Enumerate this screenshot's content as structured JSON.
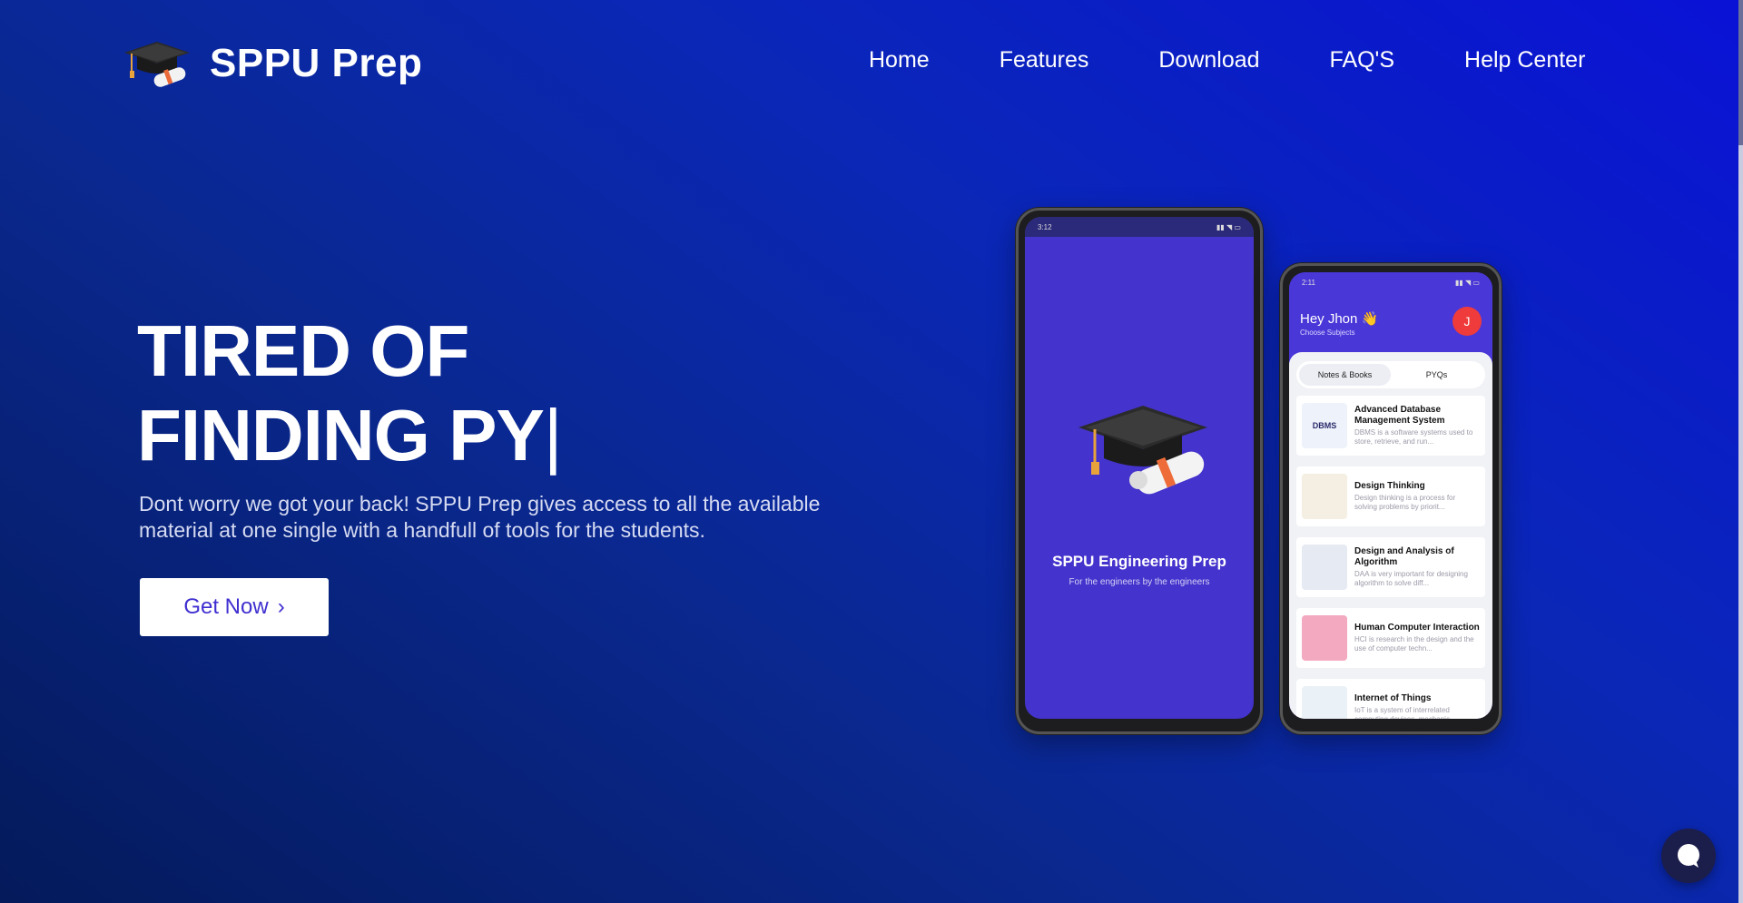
{
  "brand": {
    "name": "SPPU Prep",
    "logo_icon": "graduation-cap-icon"
  },
  "nav": {
    "items": [
      {
        "label": "Home"
      },
      {
        "label": "Features"
      },
      {
        "label": "Download"
      },
      {
        "label": "FAQ'S"
      },
      {
        "label": "Help Center"
      }
    ]
  },
  "hero": {
    "headline_line1": "TIRED OF",
    "headline_line2": "FINDING PY",
    "cursor": "|",
    "subtitle": "Dont worry we got your back! SPPU Prep gives access to all the available material at one single with a handfull of tools for the students.",
    "cta_label": "Get Now",
    "cta_arrow": "›"
  },
  "phone_splash": {
    "status_time": "3:12",
    "title": "SPPU Engineering Prep",
    "subtitle": "For the engineers by the engineers"
  },
  "phone_home": {
    "status_time": "2:11",
    "greeting": "Hey Jhon 👋",
    "greeting_sub": "Choose Subjects",
    "avatar_initial": "J",
    "tabs": [
      {
        "label": "Notes & Books"
      },
      {
        "label": "PYQs"
      }
    ],
    "subjects": [
      {
        "title": "Advanced Database Management System",
        "desc": "DBMS is a software systems used to store, retrieve, and run...",
        "thumb": "DBMS"
      },
      {
        "title": "Design Thinking",
        "desc": "Design thinking is a process for solving problems by priorit...",
        "thumb": ""
      },
      {
        "title": "Design and Analysis of Algorithm",
        "desc": "DAA is very important for designing algorithm to solve diff...",
        "thumb": ""
      },
      {
        "title": "Human Computer Interaction",
        "desc": "HCI is research in the design and the use of computer techn...",
        "thumb": ""
      },
      {
        "title": "Internet of Things",
        "desc": "IoT is a system of interrelated computing devices, mechanic...",
        "thumb": ""
      }
    ]
  },
  "colors": {
    "accent": "#3f2fd0",
    "bg_start": "#041a5a",
    "bg_end": "#0a12d6",
    "avatar": "#ef3b3b"
  },
  "chat": {
    "icon": "chat-bubble-icon"
  }
}
